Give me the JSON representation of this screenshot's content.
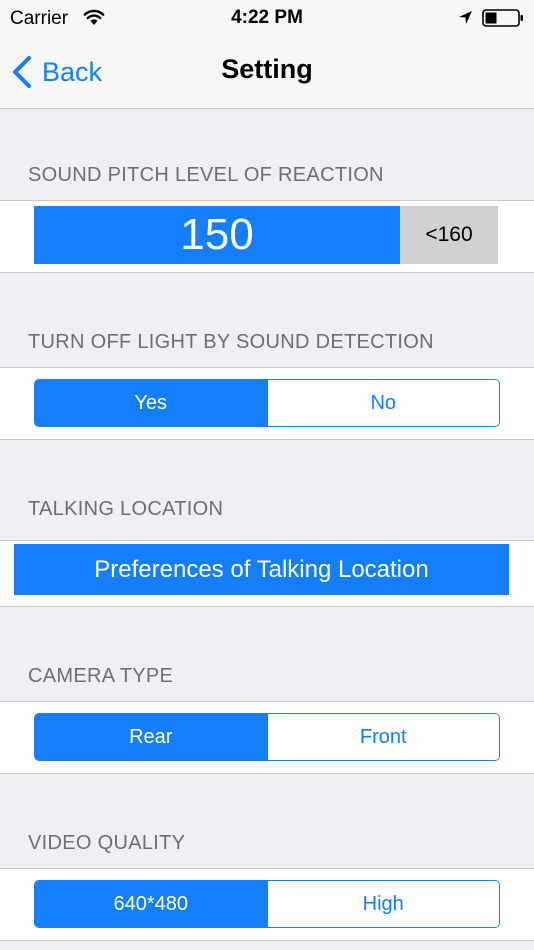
{
  "status_bar": {
    "carrier": "Carrier",
    "time": "4:22 PM",
    "icons": [
      "wifi-icon",
      "location-arrow-icon",
      "battery-icon"
    ]
  },
  "nav": {
    "back_label": "Back",
    "title": "Setting",
    "back_icon": "chevron-left-icon"
  },
  "sections": {
    "pitch": {
      "header": "SOUND PITCH LEVEL OF REACTION",
      "value": "150",
      "limit_label": "<160",
      "fill_fraction": 0.789
    },
    "turn_off_light": {
      "header": "TURN OFF LIGHT BY SOUND DETECTION",
      "options": [
        "Yes",
        "No"
      ],
      "selected": "Yes"
    },
    "talking_location": {
      "header": "TALKING LOCATION",
      "button_label": "Preferences of Talking Location"
    },
    "camera_type": {
      "header": "CAMERA TYPE",
      "options": [
        "Rear",
        "Front"
      ],
      "selected": "Rear"
    },
    "video_quality": {
      "header": "VIDEO QUALITY",
      "options": [
        "640*480",
        "High"
      ],
      "selected": "640*480"
    }
  },
  "colors": {
    "accent": "#147efb",
    "background": "#efeff4",
    "header_text": "#6d6d72",
    "track": "#d0d0d0"
  }
}
